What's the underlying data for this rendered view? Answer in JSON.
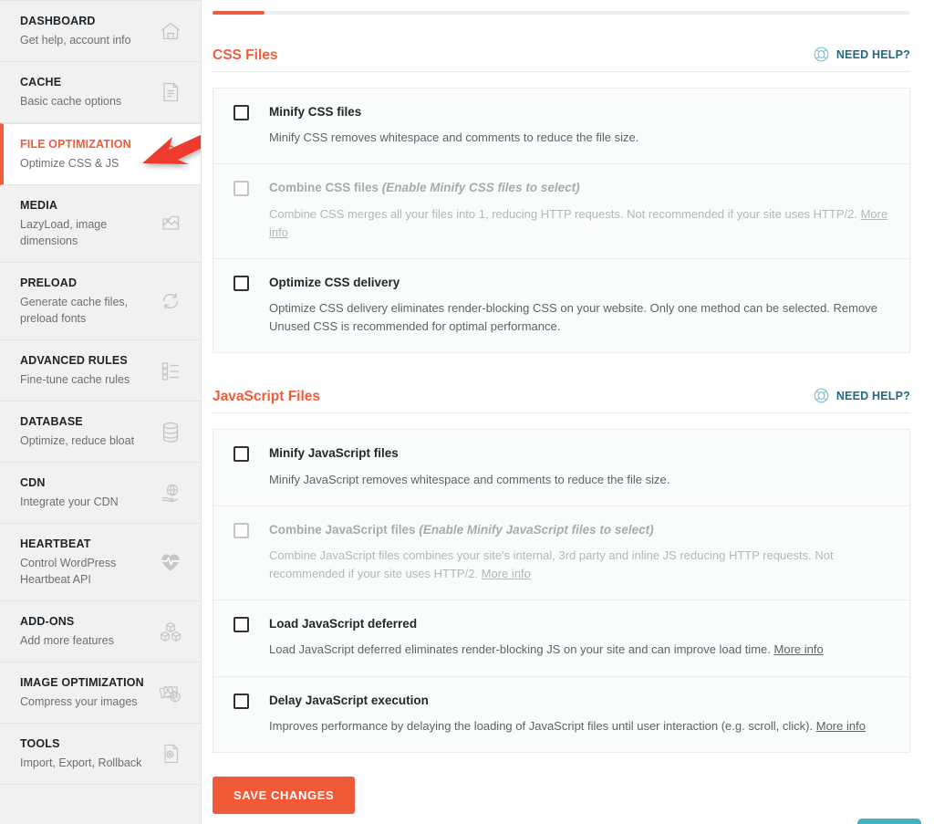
{
  "sidebar": {
    "items": [
      {
        "title": "DASHBOARD",
        "subtitle": "Get help, account info",
        "icon": "home-icon",
        "active": false
      },
      {
        "title": "CACHE",
        "subtitle": "Basic cache options",
        "icon": "document-icon",
        "active": false
      },
      {
        "title": "FILE OPTIMIZATION",
        "subtitle": "Optimize CSS & JS",
        "icon": "layers-icon",
        "active": true
      },
      {
        "title": "MEDIA",
        "subtitle": "LazyLoad, image dimensions",
        "icon": "image-icon",
        "active": false
      },
      {
        "title": "PRELOAD",
        "subtitle": "Generate cache files, preload fonts",
        "icon": "refresh-icon",
        "active": false
      },
      {
        "title": "ADVANCED RULES",
        "subtitle": "Fine-tune cache rules",
        "icon": "checklist-icon",
        "active": false
      },
      {
        "title": "DATABASE",
        "subtitle": "Optimize, reduce bloat",
        "icon": "database-icon",
        "active": false
      },
      {
        "title": "CDN",
        "subtitle": "Integrate your CDN",
        "icon": "cdn-globe-hand-icon",
        "active": false
      },
      {
        "title": "HEARTBEAT",
        "subtitle": "Control WordPress Heartbeat API",
        "icon": "heart-pulse-icon",
        "active": false
      },
      {
        "title": "ADD-ONS",
        "subtitle": "Add more features",
        "icon": "blocks-icon",
        "active": false
      },
      {
        "title": "IMAGE OPTIMIZATION",
        "subtitle": "Compress your images",
        "icon": "photos-icon",
        "active": false
      },
      {
        "title": "TOOLS",
        "subtitle": "Import, Export, Rollback",
        "icon": "file-gear-icon",
        "active": false
      }
    ]
  },
  "main": {
    "need_help_label": "NEED HELP?",
    "sections": [
      {
        "title": "CSS Files",
        "options": [
          {
            "label": "Minify CSS files",
            "hint": "",
            "description": "Minify CSS removes whitespace and comments to reduce the file size.",
            "link": "",
            "checked": false,
            "disabled": false
          },
          {
            "label": "Combine CSS files",
            "hint": "(Enable Minify CSS files to select)",
            "description": "Combine CSS merges all your files into 1, reducing HTTP requests. Not recommended if your site uses HTTP/2.",
            "link": "More info",
            "checked": false,
            "disabled": true
          },
          {
            "label": "Optimize CSS delivery",
            "hint": "",
            "description": "Optimize CSS delivery eliminates render-blocking CSS on your website. Only one method can be selected. Remove Unused CSS is recommended for optimal performance.",
            "link": "",
            "checked": false,
            "disabled": false
          }
        ]
      },
      {
        "title": "JavaScript Files",
        "options": [
          {
            "label": "Minify JavaScript files",
            "hint": "",
            "description": "Minify JavaScript removes whitespace and comments to reduce the file size.",
            "link": "",
            "checked": false,
            "disabled": false
          },
          {
            "label": "Combine JavaScript files",
            "hint": "(Enable Minify JavaScript files to select)",
            "description": "Combine JavaScript files combines your site's internal, 3rd party and inline JS reducing HTTP requests. Not recommended if your site uses HTTP/2.",
            "link": "More info",
            "checked": false,
            "disabled": true
          },
          {
            "label": "Load JavaScript deferred",
            "hint": "",
            "description": "Load JavaScript deferred eliminates render-blocking JS on your site and can improve load time.",
            "link": "More info",
            "checked": false,
            "disabled": false
          },
          {
            "label": "Delay JavaScript execution",
            "hint": "",
            "description": "Improves performance by delaying the loading of JavaScript files until user interaction (e.g. scroll, click).",
            "link": "More info",
            "checked": false,
            "disabled": false
          }
        ]
      }
    ],
    "save_label": "SAVE CHANGES"
  },
  "colors": {
    "accent_orange": "#f05d3a",
    "save_button": "#f15a36",
    "need_help_text": "#1f6a80",
    "need_help_icon": "#7fc3d6",
    "sidebar_bg": "#f1f1f1",
    "card_bg": "#fafbfb",
    "annotation_arrow": "#ef3b2d",
    "chat_widget": "#46b0c0"
  },
  "annotation": {
    "type": "arrow",
    "points_to": "sidebar-item-file-optimization"
  }
}
